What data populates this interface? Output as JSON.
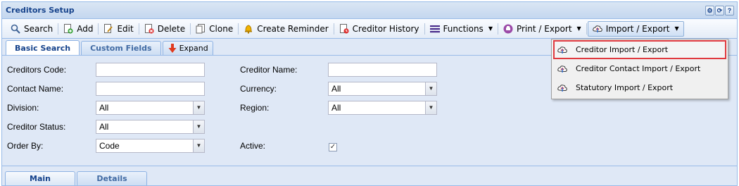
{
  "window": {
    "title": "Creditors Setup",
    "tools": [
      "gear-icon",
      "refresh-icon",
      "help-icon"
    ],
    "help_glyph": "?"
  },
  "toolbar": {
    "search": "Search",
    "add": "Add",
    "edit": "Edit",
    "delete": "Delete",
    "clone": "Clone",
    "create_reminder": "Create Reminder",
    "creditor_history": "Creditor History",
    "functions": "Functions",
    "print_export": "Print / Export",
    "import_export": "Import / Export"
  },
  "tabs": {
    "basic_search": "Basic Search",
    "custom_fields": "Custom Fields",
    "expand": "Expand"
  },
  "form": {
    "creditors_code": {
      "label": "Creditors Code:",
      "value": ""
    },
    "creditor_name": {
      "label": "Creditor Name:",
      "value": ""
    },
    "contact_name": {
      "label": "Contact Name:",
      "value": ""
    },
    "currency": {
      "label": "Currency:",
      "value": "All"
    },
    "division": {
      "label": "Division:",
      "value": "All"
    },
    "region": {
      "label": "Region:",
      "value": "All"
    },
    "creditor_status": {
      "label": "Creditor Status:",
      "value": "All"
    },
    "order_by": {
      "label": "Order By:",
      "value": "Code"
    },
    "active": {
      "label": "Active:",
      "checked": true,
      "check_glyph": "✓"
    }
  },
  "import_export_menu": {
    "items": [
      "Creditor Import / Export",
      "Creditor Contact Import / Export",
      "Statutory Import / Export"
    ]
  },
  "bottom_tabs": {
    "main": "Main",
    "details": "Details"
  },
  "colors": {
    "accent": "#15428b",
    "highlight_border": "#e0393e"
  }
}
